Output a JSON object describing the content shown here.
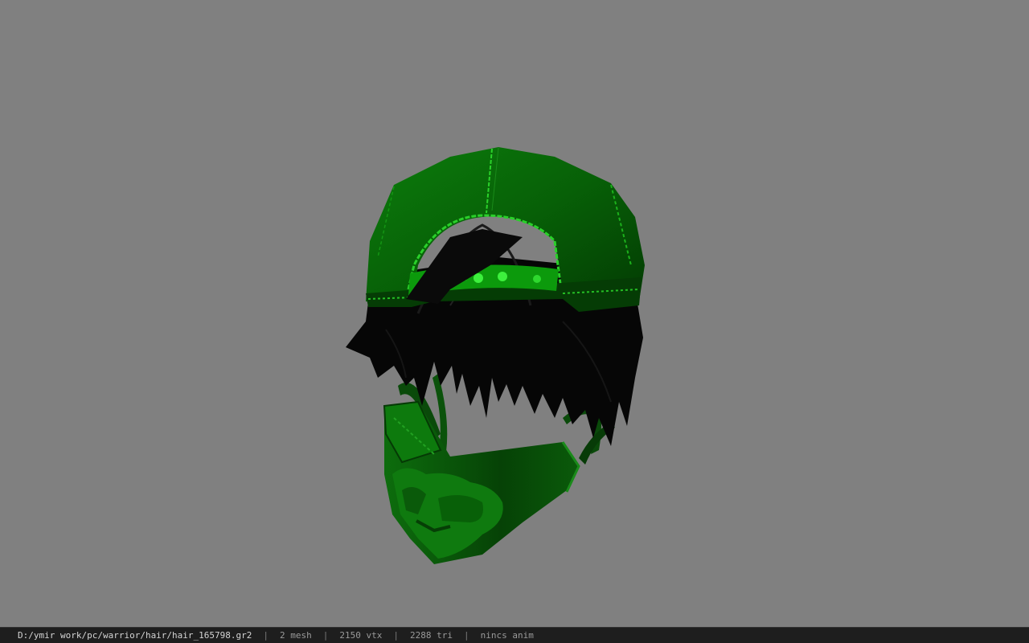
{
  "viewer": {
    "background_color": "#808080",
    "model": {
      "description": "3d-hair-model",
      "cap_color": "#0a6b0a",
      "cap_highlight": "#22c922",
      "hair_color": "#050505",
      "mask_color": "#0b5e0b",
      "mask_emblem_color": "#0f7a0f"
    }
  },
  "status_bar": {
    "file_path": "D:/ymir work/pc/warrior/hair/hair_165798.gr2",
    "separator": "|",
    "mesh_count": "2 mesh",
    "vertex_count": "2150 vtx",
    "triangle_count": "2288 tri",
    "anim_status": "nincs anim"
  }
}
